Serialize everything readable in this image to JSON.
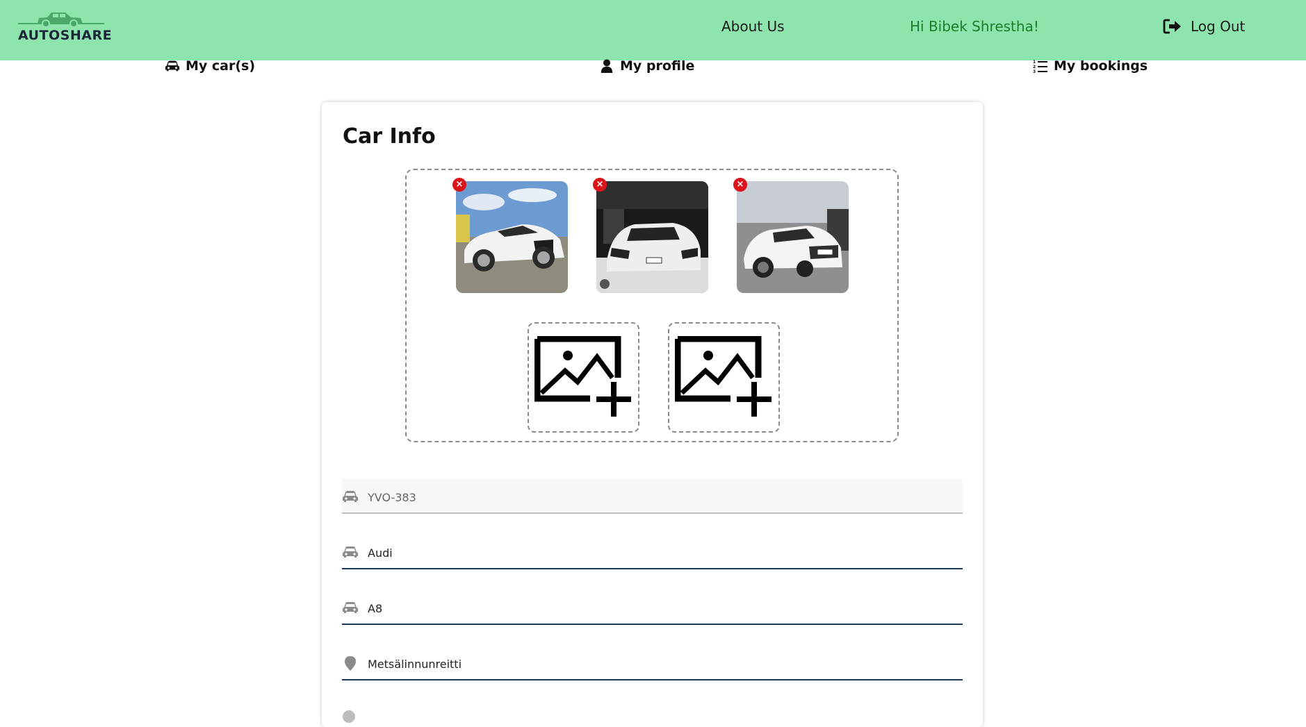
{
  "app": {
    "logo_text": "AUTOSHARE",
    "brand_color": "#8ee4ad"
  },
  "header": {
    "about_label": "About Us",
    "greeting": "Hi Bibek Shrestha!",
    "logout_label": "Log Out"
  },
  "subnav": {
    "cars_label": "My car(s)",
    "profile_label": "My profile",
    "bookings_label": "My bookings"
  },
  "card": {
    "title": "Car Info",
    "photos": [
      {
        "icon": "car-photo"
      },
      {
        "icon": "car-photo"
      },
      {
        "icon": "car-photo"
      }
    ],
    "remove_symbol": "×",
    "upload_slots": 2
  },
  "fields": {
    "registration": "YVO-383",
    "make": "Audi",
    "model": "A8",
    "location": "Metsälinnunreitti"
  },
  "colors": {
    "greeting": "#1a7f2a",
    "remove": "#d9141a",
    "underline": "#1d3557"
  }
}
